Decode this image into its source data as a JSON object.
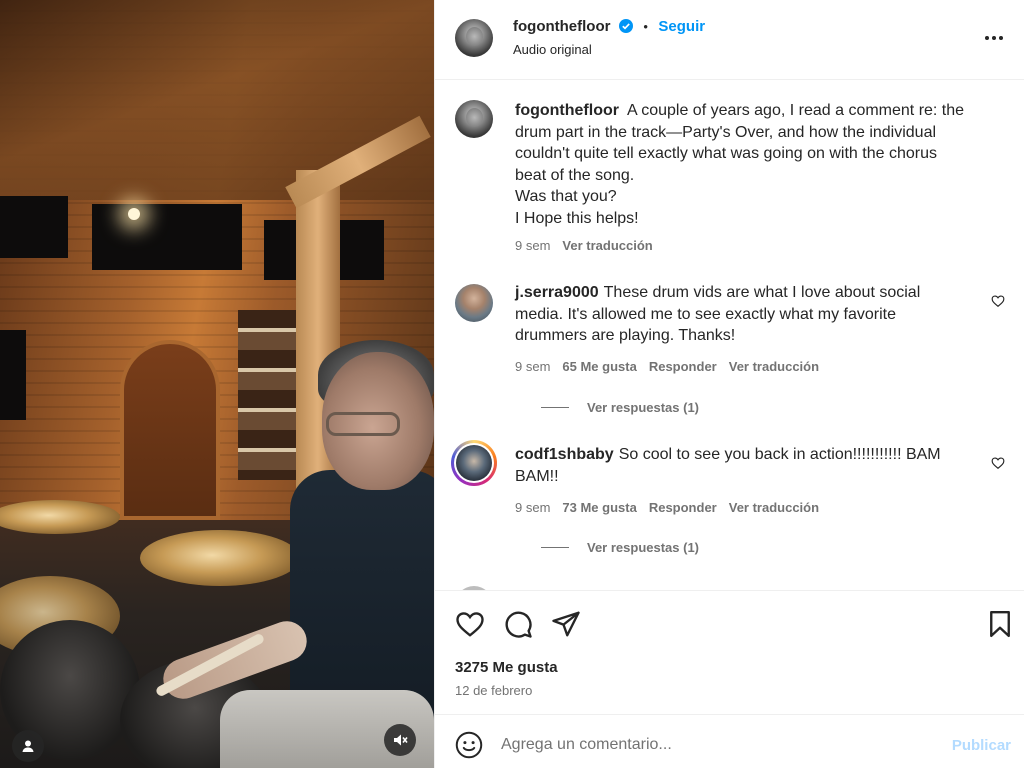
{
  "post": {
    "username": "fogonthefloor",
    "follow_label": "Seguir",
    "dot": "•",
    "subtitle": "Audio original",
    "colors": {
      "link": "#0095f6",
      "verified": "#0095f6",
      "muted": "#737373",
      "publish_disabled": "#b3dbff"
    }
  },
  "caption": {
    "username": "fogonthefloor",
    "lines": [
      "A couple of years ago, I read a comment re: the",
      "drum part in the track—Party's Over, and how the individual",
      "couldn't quite tell exactly what was going on with the chorus",
      "beat of the song.",
      "Was that you?",
      "I Hope this helps!"
    ],
    "time": "9 sem",
    "translate": "Ver traducción"
  },
  "comments": [
    {
      "username": "j.serra9000",
      "lines": [
        "These drum vids are what I love about social",
        "media. It's allowed me to see exactly what my favorite",
        "drummers are playing. Thanks!"
      ],
      "time": "9 sem",
      "likes": "65 Me gusta",
      "reply": "Responder",
      "translate": "Ver traducción",
      "view_replies": "Ver respuestas (1)"
    },
    {
      "username": "codf1shbaby",
      "lines": [
        "So cool to see you back in action!!!!!!!!!!! BAM",
        "BAM!!"
      ],
      "time": "9 sem",
      "likes": "73 Me gusta",
      "reply": "Responder",
      "translate": "Ver traducción",
      "view_replies": "Ver respuestas (1)"
    }
  ],
  "footer": {
    "likes": "3275 Me gusta",
    "date": "12 de febrero",
    "comment_placeholder": "Agrega un comentario...",
    "publish": "Publicar"
  },
  "icons": {
    "more": "more-options-icon",
    "like": "heart-icon",
    "comment": "comment-icon",
    "share": "share-icon",
    "save": "bookmark-icon",
    "emoji": "emoji-icon",
    "mute": "muted-speaker-icon",
    "tagged": "user-tag-icon"
  }
}
